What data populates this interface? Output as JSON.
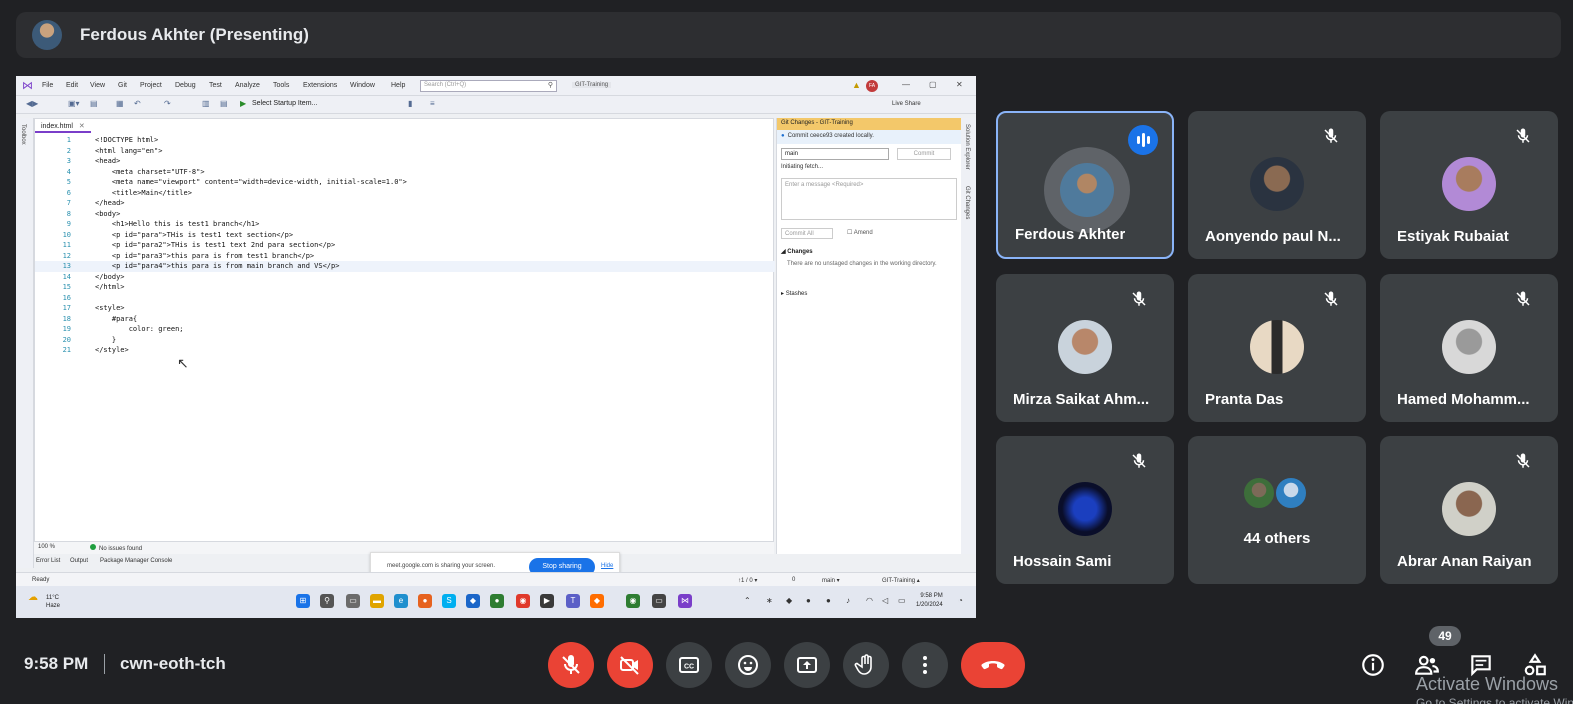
{
  "header": {
    "presenter_title": "Ferdous Akhter (Presenting)"
  },
  "shared_screen": {
    "menu": [
      "File",
      "Edit",
      "View",
      "Git",
      "Project",
      "Debug",
      "Test",
      "Analyze",
      "Tools",
      "Extensions",
      "Window",
      "Help"
    ],
    "search_placeholder": "Search (Ctrl+Q)",
    "solution_name": "GIT-Training",
    "user_initials": "FA",
    "startup_item": "Select Startup Item...",
    "live_share": "Live Share",
    "toolbox_label": "Toolbox",
    "editor_tab": "index.html",
    "code_lines": [
      {
        "n": "1",
        "t": "<!DOCTYPE html>"
      },
      {
        "n": "2",
        "t": "<html lang=\"en\">"
      },
      {
        "n": "3",
        "t": "<head>"
      },
      {
        "n": "4",
        "t": "    <meta charset=\"UTF-8\">"
      },
      {
        "n": "5",
        "t": "    <meta name=\"viewport\" content=\"width=device-width, initial-scale=1.0\">"
      },
      {
        "n": "6",
        "t": "    <title>Main</title>"
      },
      {
        "n": "7",
        "t": "</head>"
      },
      {
        "n": "8",
        "t": "<body>"
      },
      {
        "n": "9",
        "t": "    <h1>Hello this is test1 branch</h1>"
      },
      {
        "n": "10",
        "t": "    <p id=\"para\">THis is test1 text section</p>"
      },
      {
        "n": "11",
        "t": "    <p id=\"para2\">THis is test1 text 2nd para section</p>"
      },
      {
        "n": "12",
        "t": "    <p id=\"para3\">this para is from test1 branch</p>"
      },
      {
        "n": "13",
        "t": "    <p id=\"para4\">this para is from main branch and VS</p>"
      },
      {
        "n": "14",
        "t": "</body>"
      },
      {
        "n": "15",
        "t": "</html>"
      },
      {
        "n": "16",
        "t": ""
      },
      {
        "n": "17",
        "t": "<style>"
      },
      {
        "n": "18",
        "t": "    #para{"
      },
      {
        "n": "19",
        "t": "        color: green;"
      },
      {
        "n": "20",
        "t": "    }"
      },
      {
        "n": "21",
        "t": "</style>"
      }
    ],
    "zoom": "100 %",
    "issues": "No issues found",
    "git_panel": {
      "title": "Git Changes - GIT-Training",
      "info": "Commit ceece93 created locally.",
      "branch": "main",
      "commit_button": "Commit",
      "fetch_status": "Initiating fetch...",
      "message_placeholder": "Enter a message <Required>",
      "commit_all": "Commit All",
      "amend": "Amend",
      "changes_header": "Changes",
      "no_changes": "There are no unstaged changes in the working directory.",
      "stashes": "Stashes"
    },
    "side_strip": [
      "Solution Explorer",
      "Git Changes"
    ],
    "bottom_tabs": [
      "Error List",
      "Output",
      "Package Manager Console"
    ],
    "share_bar": {
      "text": "meet.google.com is sharing your screen.",
      "stop": "Stop sharing",
      "hide": "Hide"
    },
    "status": {
      "ready": "Ready",
      "updown": "↑1 / 0 ▾",
      "pencil": "0",
      "branch": "main ▾",
      "repo": "GIT-Training ▴"
    },
    "taskbar": {
      "temp": "11°C",
      "weather": "Haze",
      "time": "9:58 PM",
      "date": "1/20/2024"
    }
  },
  "participants": [
    {
      "name": "Ferdous Akhter",
      "state": "speaking"
    },
    {
      "name": "Aonyendo paul N...",
      "state": "muted"
    },
    {
      "name": "Estiyak Rubaiat",
      "state": "muted"
    },
    {
      "name": "Mirza Saikat Ahm...",
      "state": "muted"
    },
    {
      "name": "Pranta Das",
      "state": "muted"
    },
    {
      "name": "Hamed Mohamm...",
      "state": "muted"
    },
    {
      "name": "Hossain Sami",
      "state": "muted"
    },
    {
      "name": "44 others",
      "state": "group"
    },
    {
      "name": "Abrar Anan Raiyan",
      "state": "muted"
    }
  ],
  "footer": {
    "time": "9:58 PM",
    "meeting_code": "cwn-eoth-tch",
    "participant_count": "49",
    "watermark": "Activate Windows",
    "watermark_sub": "Go to Settings to activate Windows."
  },
  "colors": {
    "accent": "#8ab4f8",
    "danger": "#ea4335",
    "tile": "#3c4043",
    "background": "#202124"
  }
}
